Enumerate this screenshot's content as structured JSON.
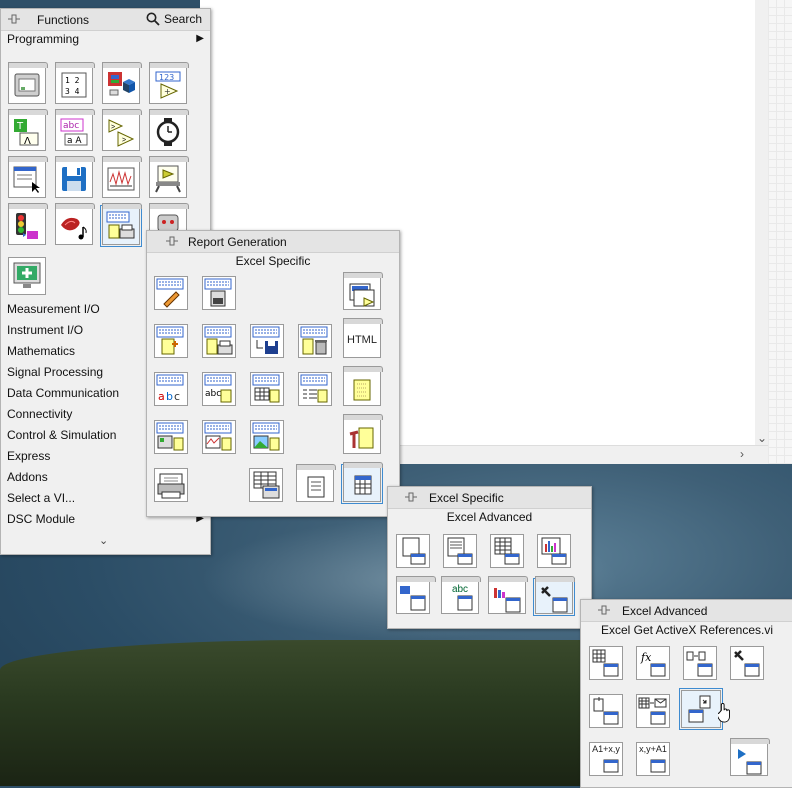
{
  "functions": {
    "title": "Functions",
    "search_label": "Search",
    "category": "Programming",
    "categories": [
      "Measurement I/O",
      "Instrument I/O",
      "Mathematics",
      "Signal Processing",
      "Data Communication",
      "Connectivity",
      "Control & Simulation",
      "Express",
      "Addons",
      "Select a VI...",
      "DSC Module"
    ],
    "icons": [
      "structures-icon",
      "array-icon",
      "cluster-icon",
      "numeric-icon",
      "boolean-icon",
      "string-icon",
      "comparison-icon",
      "timing-icon",
      "dialog-icon",
      "file-io-icon",
      "waveform-icon",
      "application-control-icon",
      "synchronization-icon",
      "graphics-sound-icon",
      "report-generation-icon",
      "robot-icon",
      "add-vi-icon"
    ]
  },
  "report_generation": {
    "title": "Report Generation",
    "subtitle": "Excel Specific",
    "html_label": "HTML"
  },
  "excel_specific": {
    "title": "Excel Specific",
    "subtitle": "Excel Advanced",
    "abc_label": "abc"
  },
  "excel_advanced": {
    "title": "Excel Advanced",
    "subtitle": "Excel Get ActiveX References.vi",
    "a1_to_xy": "A1+x,y",
    "xy_to_a1": "x,y+A1"
  },
  "colors": {
    "selection": "#3e8bd0",
    "panel": "#f0f0f0",
    "header": "#e4e4e4"
  }
}
